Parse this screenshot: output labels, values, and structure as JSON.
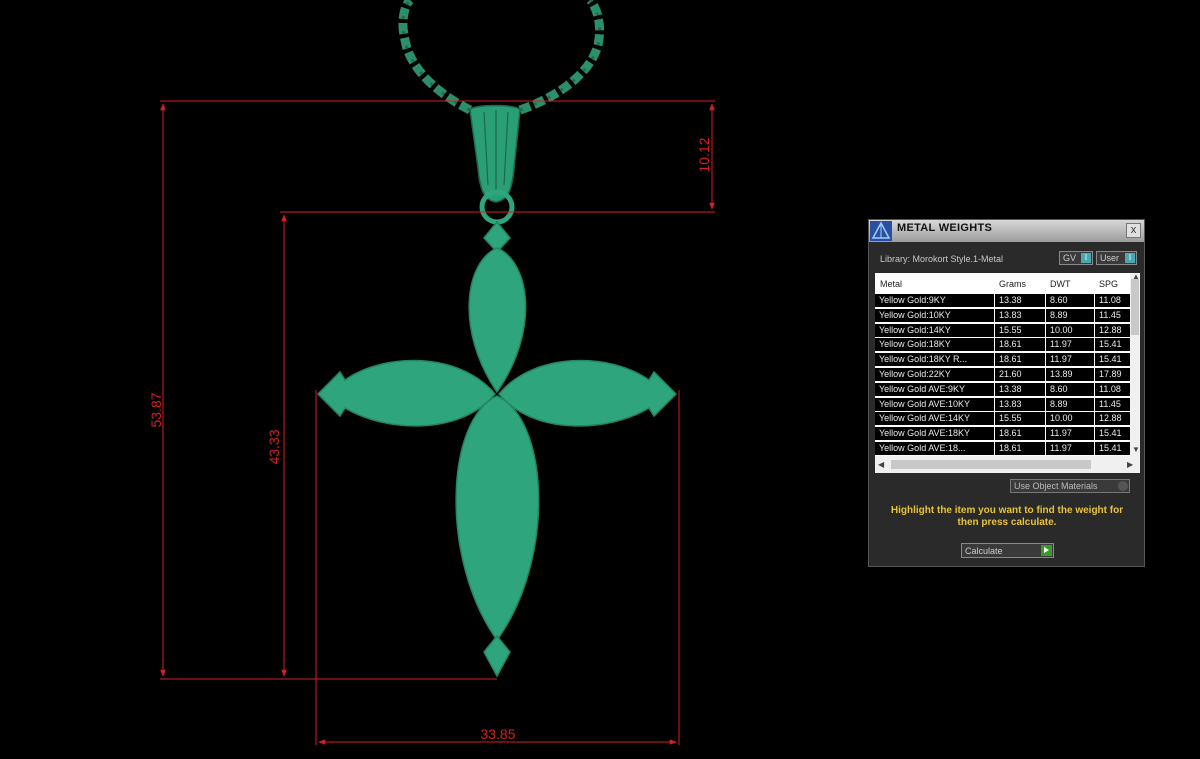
{
  "dimensions": {
    "total_height": "53.87",
    "cross_height": "43.33",
    "bail_height": "10.12",
    "cross_width": "33.85"
  },
  "colors": {
    "model": "#2ea57c",
    "dimension_lines": "#d42020",
    "instruction_text": "#e8c33a"
  },
  "panel": {
    "title": "METAL WEIGHTS",
    "library": "Library: Morokort Style.1-Metal",
    "toggle_gv": "GV",
    "toggle_user": "User",
    "columns": [
      "Metal",
      "Grams",
      "DWT",
      "SPG"
    ],
    "rows": [
      [
        "Yellow Gold:9KY",
        "13.38",
        "8.60",
        "11.08"
      ],
      [
        "Yellow Gold:10KY",
        "13.83",
        "8.89",
        "11.45"
      ],
      [
        "Yellow Gold:14KY",
        "15.55",
        "10.00",
        "12.88"
      ],
      [
        "Yellow Gold:18KY",
        "18.61",
        "11.97",
        "15.41"
      ],
      [
        "Yellow Gold:18KY R...",
        "18.61",
        "11.97",
        "15.41"
      ],
      [
        "Yellow Gold:22KY",
        "21.60",
        "13.89",
        "17.89"
      ],
      [
        "Yellow Gold AVE:9KY",
        "13.38",
        "8.60",
        "11.08"
      ],
      [
        "Yellow Gold AVE:10KY",
        "13.83",
        "8.89",
        "11.45"
      ],
      [
        "Yellow Gold AVE:14KY",
        "15.55",
        "10.00",
        "12.88"
      ],
      [
        "Yellow Gold AVE:18KY",
        "18.61",
        "11.97",
        "15.41"
      ],
      [
        "Yellow Gold AVE:18...",
        "18.61",
        "11.97",
        "15.41"
      ]
    ],
    "use_object_materials": "Use Object Materials",
    "instruction": "Highlight the item you want to find the weight for then press calculate.",
    "calculate": "Calculate",
    "close": "x",
    "toggle_knob": "I"
  }
}
